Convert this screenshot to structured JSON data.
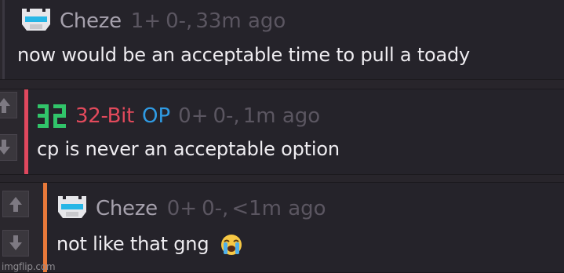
{
  "comments": [
    {
      "username": "Cheze",
      "badge": "",
      "upvotes": "1+",
      "downvotes": "0-,",
      "time": "33m ago",
      "text": "now would be an acceptable time to pull a toady",
      "accent": "#3a3740",
      "avatar_icon": "blue-visor-helmet-icon"
    },
    {
      "username": "32-Bit",
      "badge": "OP",
      "upvotes": "0+",
      "downvotes": "0-,",
      "time": "1m ago",
      "text": "cp is never an acceptable option",
      "accent": "#e0485e",
      "avatar_icon": "green-32-pixel-logo-icon"
    },
    {
      "username": "Cheze",
      "badge": "",
      "upvotes": "0+",
      "downvotes": "0-,",
      "time": "<1m ago",
      "text": "not like that gng",
      "accent": "#e8793a",
      "avatar_icon": "blue-visor-helmet-icon",
      "emoji": "loudly-crying-face-icon"
    }
  ],
  "watermark": "imgflip.com",
  "colors": {
    "background": "#28252b",
    "username_default": "#a6a1ad",
    "username_op_author": "#e34a5c",
    "op_badge": "#2f9be4",
    "meta": "#5b5661"
  }
}
